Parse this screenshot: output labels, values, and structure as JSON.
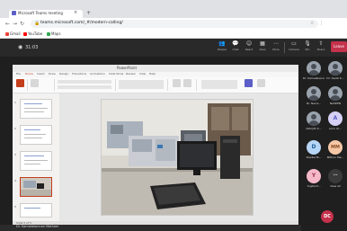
{
  "browser": {
    "tab_title": "Microsoft Teams meeting",
    "tab_close": "×",
    "new_tab": "+",
    "nav": {
      "back": "←",
      "forward": "→",
      "reload": "↻"
    },
    "lock": "🔒",
    "url": "teams.microsoft.com/_#/modern-calling/",
    "extensions": "☆ ⋮",
    "bookmarks": [
      "Gmail",
      "YouTube",
      "Maps"
    ],
    "bookmark_colors": [
      "#ea4335",
      "#ff0000",
      "#34a853"
    ]
  },
  "teams": {
    "timer_icon": "◉",
    "timer": "31:03",
    "controls": [
      {
        "label": "People",
        "icon": "people-icon",
        "glyph": "👥"
      },
      {
        "label": "Chat",
        "icon": "chat-icon",
        "glyph": "💬"
      },
      {
        "label": "React",
        "icon": "react-icon",
        "glyph": "☺"
      },
      {
        "label": "View",
        "icon": "view-icon",
        "glyph": "▦"
      },
      {
        "label": "More",
        "icon": "more-icon",
        "glyph": "⋯"
      },
      {
        "label": "Camera",
        "icon": "camera-icon",
        "glyph": "▭"
      },
      {
        "label": "Mic",
        "icon": "mic-icon",
        "glyph": "🎙"
      },
      {
        "label": "Share",
        "icon": "share-icon",
        "glyph": "⇧"
      }
    ],
    "leave": "Leave",
    "leave_color": "#c4314b"
  },
  "ppt": {
    "title": "PowerPoint",
    "ribbon_tabs": [
      "File",
      "Home",
      "Insert",
      "Draw",
      "Design",
      "Transitions",
      "Animations",
      "Slide Show",
      "Review",
      "View",
      "Help"
    ],
    "thumb_numbers": [
      "1",
      "2",
      "3",
      "4",
      "5"
    ],
    "status": "Slide 5 of 5"
  },
  "participants": [
    {
      "name": "Dr. Kamalakannan",
      "initials": "",
      "color": "#9aa3ad",
      "photo": true
    },
    {
      "name": "Dr. Swati K...",
      "initials": "",
      "color": "#9aa3ad",
      "photo": true
    },
    {
      "name": "Dr. Narra...",
      "initials": "",
      "color": "#9aa3ad",
      "photo": true
    },
    {
      "name": "NAVEEN",
      "initials": "",
      "color": "#9aa3ad",
      "photo": true
    },
    {
      "name": "Abhijith K...",
      "initials": "",
      "color": "#9aa3ad",
      "photo": true
    },
    {
      "name": "arun ch...",
      "initials": "A",
      "color": "#d5d0f5",
      "photo": false
    },
    {
      "name": "Devika M...",
      "initials": "D",
      "color": "#b7d6f5",
      "photo": false
    },
    {
      "name": "Mithun Ma...",
      "initials": "MM",
      "color": "#f5c8a8",
      "photo": false
    },
    {
      "name": "Yogita N...",
      "initials": "Y",
      "color": "#f5b8c8",
      "photo": false
    },
    {
      "name": "View all",
      "initials": "⋯",
      "color": "#3a3a3a",
      "photo": false
    }
  ],
  "self": {
    "initials": "DC"
  },
  "bottombar": "Dr. Kamalakannan Matham"
}
